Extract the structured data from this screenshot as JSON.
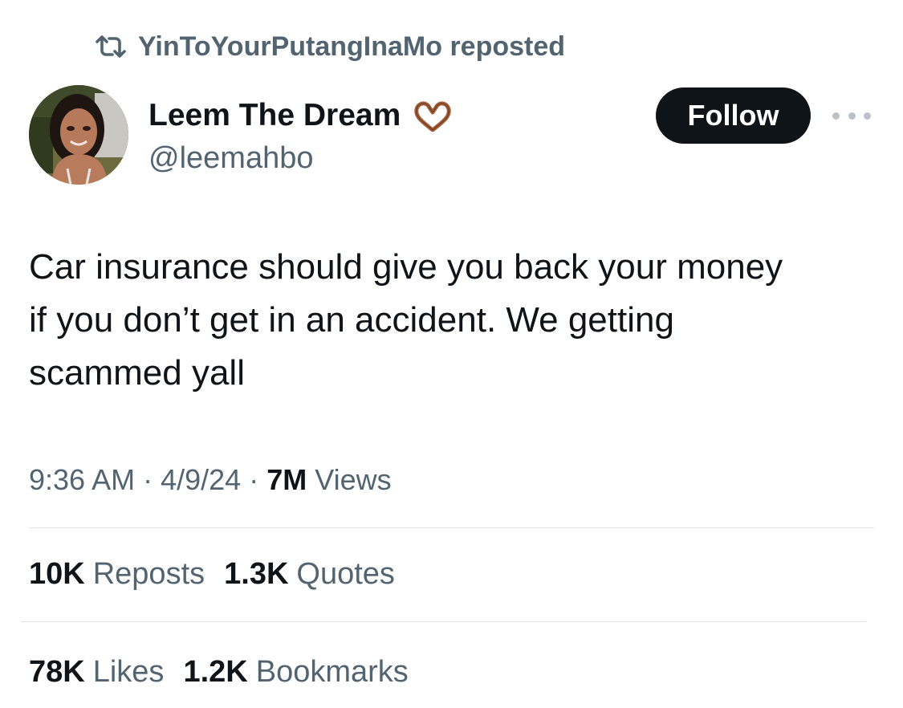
{
  "repost": {
    "icon": "repost-icon",
    "text": "YinToYourPutangInaMo reposted"
  },
  "author": {
    "display_name": "Leem The Dream",
    "emoji_icon": "heart-hands-icon",
    "handle": "@leemahbo"
  },
  "follow_label": "Follow",
  "more_icon": "more-options-icon",
  "tweet": {
    "text": "Car insurance should give you back your money\nif you don’t get in an accident. We getting\nscammed yall"
  },
  "meta": {
    "time": "9:36 AM",
    "sep1": "·",
    "date": "4/9/24",
    "sep2": "·",
    "views_count": "7M",
    "views_label": "Views"
  },
  "stats": {
    "reposts_count": "10K",
    "reposts_label": "Reposts",
    "quotes_count": "1.3K",
    "quotes_label": "Quotes",
    "likes_count": "78K",
    "likes_label": "Likes",
    "bookmarks_count": "1.2K",
    "bookmarks_label": "Bookmarks"
  },
  "colors": {
    "text_primary": "#0f1419",
    "text_secondary": "#536471",
    "button_bg": "#0f1419",
    "divider": "#dde3e7"
  }
}
